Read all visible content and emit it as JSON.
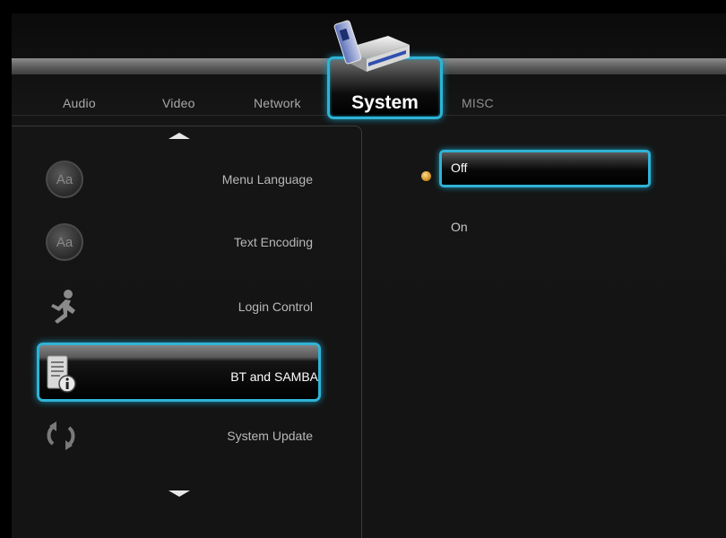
{
  "tabs": {
    "items": [
      {
        "label": "Audio"
      },
      {
        "label": "Video"
      },
      {
        "label": "Network"
      },
      {
        "label": "System"
      },
      {
        "label": "MISC"
      }
    ],
    "active": "System"
  },
  "menu": {
    "items": [
      {
        "label": "Menu Language",
        "icon": "aa-icon"
      },
      {
        "label": "Text Encoding",
        "icon": "aa-icon"
      },
      {
        "label": "Login Control",
        "icon": "running-figure-icon"
      },
      {
        "label": "BT and SAMBA",
        "icon": "document-info-icon"
      },
      {
        "label": "System Update",
        "icon": "refresh-arrows-icon"
      }
    ],
    "selected": "BT and SAMBA"
  },
  "options": {
    "items": [
      {
        "label": "Off"
      },
      {
        "label": "On"
      }
    ],
    "selected": "Off"
  },
  "colors": {
    "highlight": "#2fb3d6",
    "bullet": "#e0a030",
    "background": "#141414"
  },
  "icon_glyphs": {
    "aa": "Aa"
  }
}
